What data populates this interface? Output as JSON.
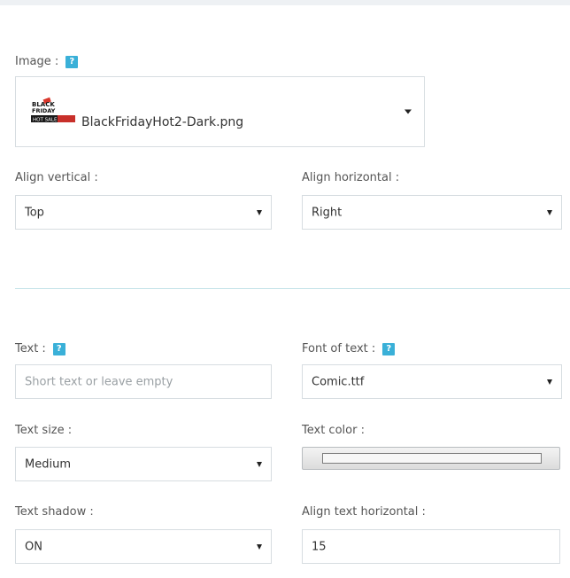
{
  "image": {
    "label": "Image :",
    "help_icon": "question-icon",
    "selected_file": "BlackFridayHot2-Dark.png",
    "thumb_text": {
      "line1": "BLACK",
      "line2": "FRIDAY",
      "line3": "HOT SALE"
    }
  },
  "align_vertical": {
    "label": "Align vertical :",
    "value": "Top"
  },
  "align_horizontal": {
    "label": "Align horizontal :",
    "value": "Right"
  },
  "text": {
    "label": "Text :",
    "help_icon": "question-icon",
    "placeholder": "Short text or leave empty",
    "value": ""
  },
  "font_of_text": {
    "label": "Font of text :",
    "help_icon": "question-icon",
    "value": "Comic.ttf"
  },
  "text_size": {
    "label": "Text size :",
    "value": "Medium"
  },
  "text_color": {
    "label": "Text color :",
    "value": "#ffffff"
  },
  "text_shadow": {
    "label": "Text shadow :",
    "value": "ON"
  },
  "align_text_horizontal": {
    "label": "Align text horizontal :",
    "value": "15"
  },
  "colors": {
    "accent": "#3ab0d8",
    "border": "#d7dde1",
    "divider": "#c7e4ea"
  }
}
